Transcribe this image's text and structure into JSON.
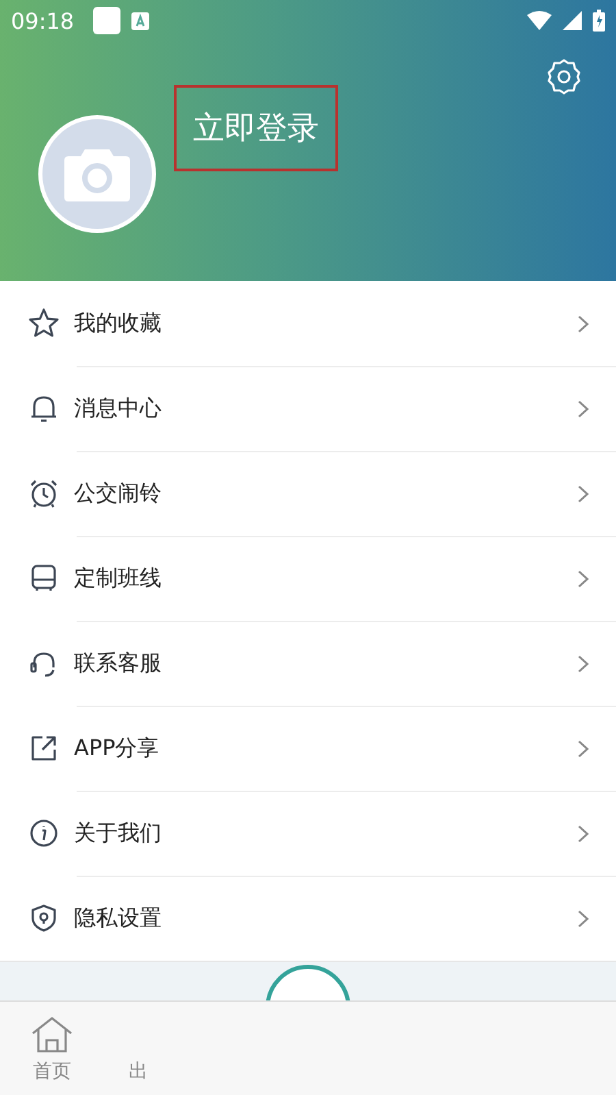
{
  "status_bar": {
    "time": "09:18"
  },
  "profile": {
    "login": "立即登录",
    "highlighted": true
  },
  "menu": [
    {
      "kind": "star",
      "label": "我的收藏"
    },
    {
      "kind": "bell",
      "label": "消息中心"
    },
    {
      "kind": "alarm",
      "label": "公交闹铃"
    },
    {
      "kind": "bus",
      "label": "定制班线"
    },
    {
      "kind": "headset",
      "label": "联系客服"
    },
    {
      "kind": "share",
      "label": "APP分享"
    },
    {
      "kind": "info",
      "label": "关于我们"
    },
    {
      "kind": "shield",
      "label": "隐私设置"
    }
  ],
  "bottom_nav": [
    {
      "kind": "home",
      "label": "首页",
      "selected": false
    },
    {
      "kind": "none",
      "label": "出",
      "selected": false
    }
  ]
}
